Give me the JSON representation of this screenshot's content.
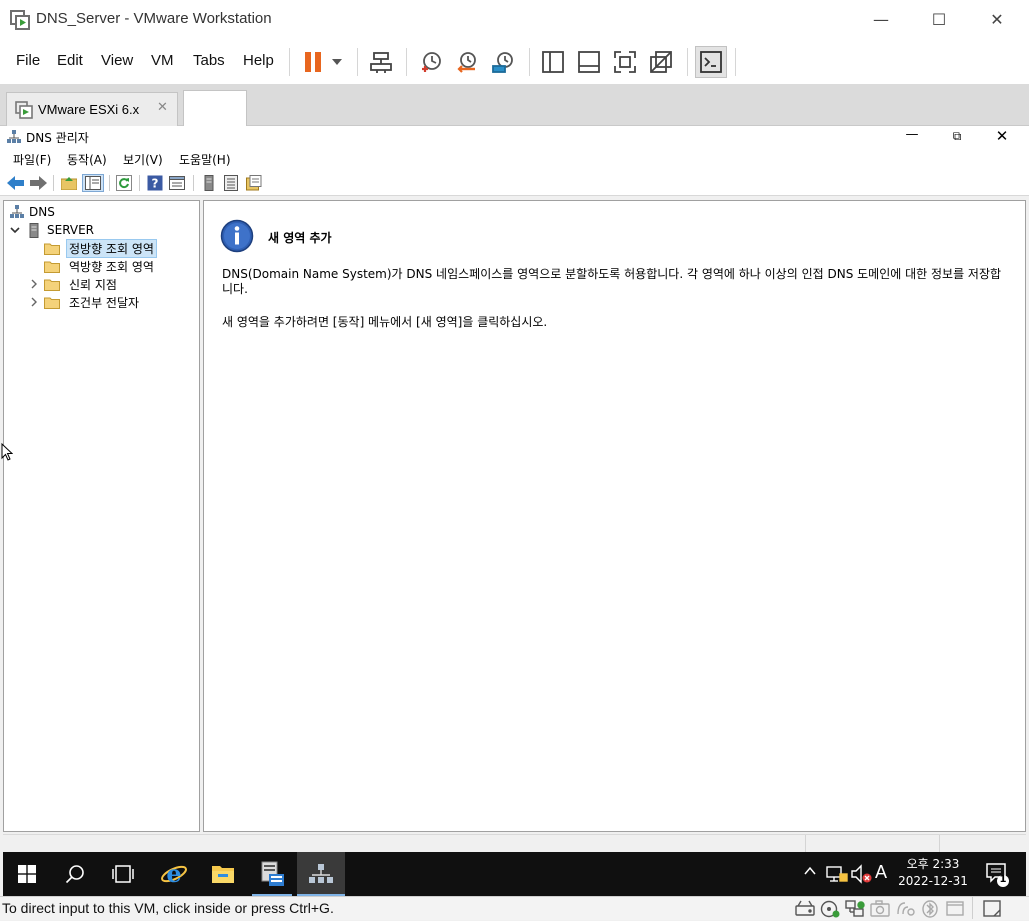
{
  "vmware": {
    "title": "DNS_Server - VMware Workstation",
    "menu": [
      "File",
      "Edit",
      "View",
      "VM",
      "Tabs",
      "Help"
    ],
    "tab_label": "VMware ESXi 6.x",
    "tab_close": "✕",
    "status_text": "To direct input to this VM, click inside or press Ctrl+G.",
    "accent_color": "#e8661f"
  },
  "dns": {
    "title": "DNS 관리자",
    "menu": [
      "파일(F)",
      "동작(A)",
      "보기(V)",
      "도움말(H)"
    ],
    "tree": {
      "root": "DNS",
      "server": "SERVER",
      "nodes": [
        "정방향 조회 영역",
        "역방향 조회 영역",
        "신뢰 지점",
        "조건부 전달자"
      ]
    },
    "content": {
      "heading": "새 영역 추가",
      "para1": "DNS(Domain Name System)가 DNS 네임스페이스를 영역으로 분할하도록 허용합니다. 각 영역에 하나 이상의 인접 DNS 도메인에 대한 정보를 저장합니다.",
      "para2": "새 영역을 추가하려면 [동작] 메뉴에서 [새 영역]을 클릭하십시오."
    }
  },
  "taskbar": {
    "time": "오후 2:33",
    "date": "2022-12-31",
    "ime": "A",
    "notification_count": "1"
  }
}
